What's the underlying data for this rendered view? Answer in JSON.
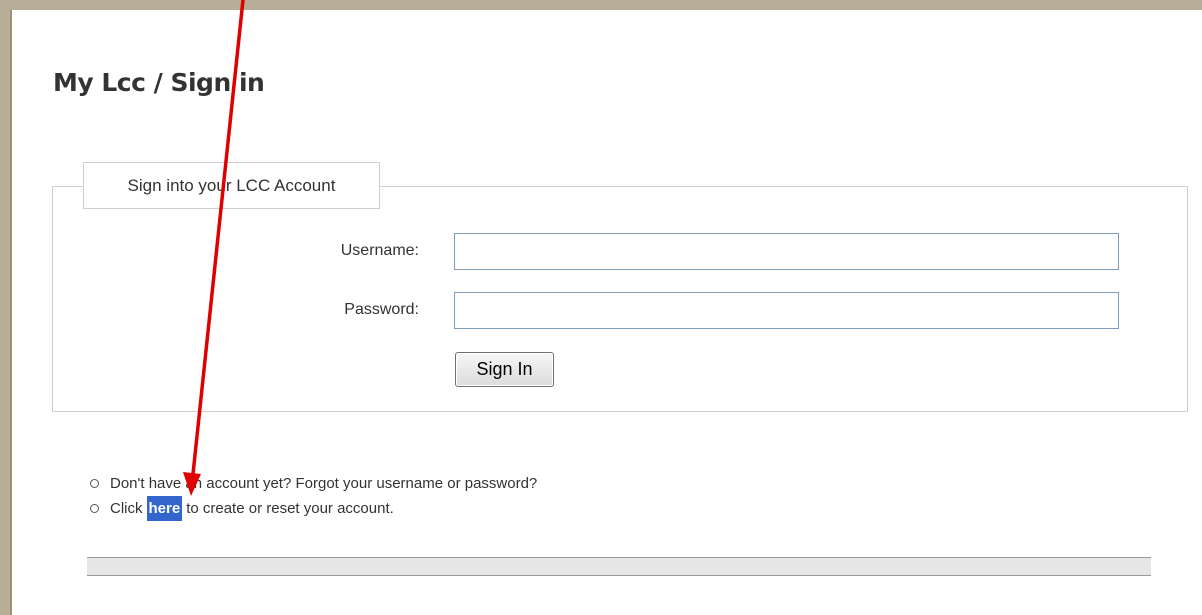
{
  "page": {
    "title": "My Lcc / Sign in"
  },
  "form": {
    "legend": "Sign into your LCC Account",
    "username_label": "Username:",
    "username_value": "",
    "password_label": "Password:",
    "password_value": "",
    "submit_label": "Sign In"
  },
  "help": {
    "line1": "Don't have an account yet? Forgot your username or password?",
    "line2_prefix": "Click",
    "line2_link": "here",
    "line2_suffix": "to create or reset your account."
  },
  "colors": {
    "frame": "#b8ad96",
    "link_highlight": "#3366cc",
    "annotation_arrow": "#e00000"
  },
  "icons": {
    "bullet": "circle-bullet-icon",
    "arrow": "red-arrow-annotation"
  }
}
